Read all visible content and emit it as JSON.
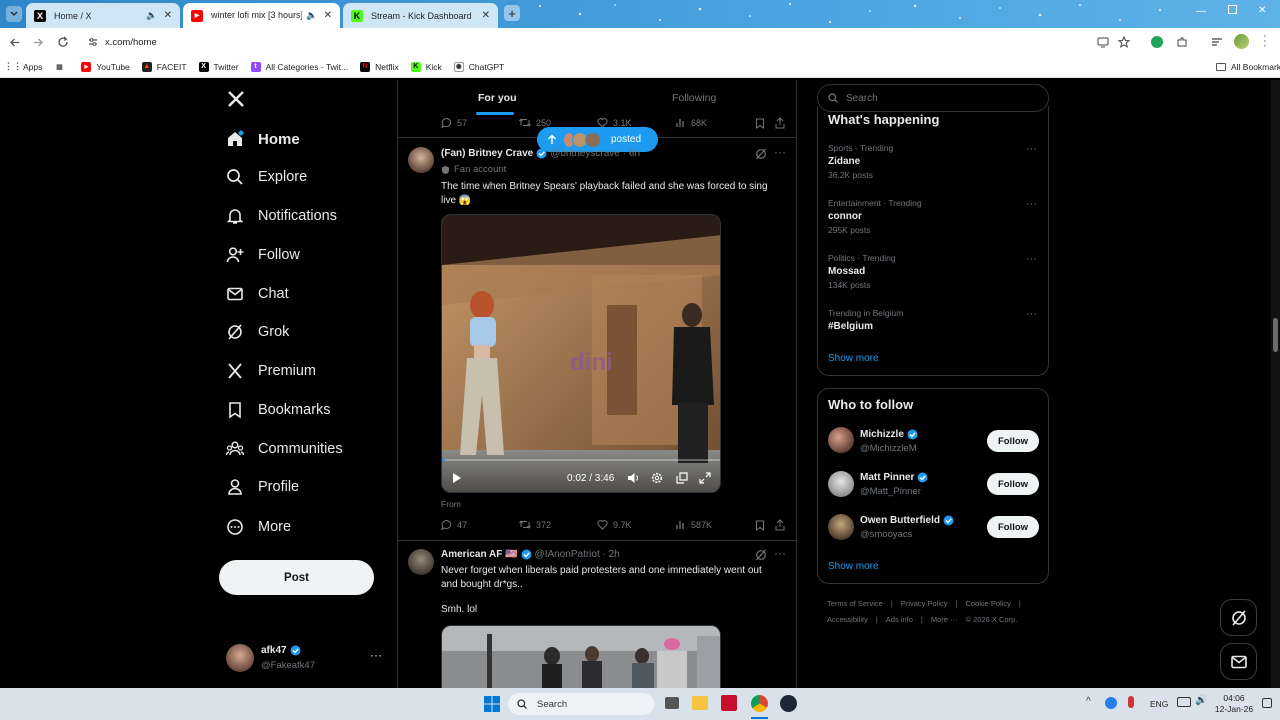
{
  "browser": {
    "tabs": [
      {
        "title": "Home / X",
        "favicon": "X"
      },
      {
        "title": "winter lofi mix [3 hours] ❄️",
        "favicon": "▶"
      },
      {
        "title": "Stream - Kick Dashboard",
        "favicon": "K"
      }
    ],
    "new_tab": "+",
    "url": "x.com/home",
    "bookmarks": [
      "Apps",
      "YouTube",
      "FACEIT",
      "Twitter",
      "All Categories - Twit...",
      "Netflix",
      "Kick",
      "ChatGPT"
    ],
    "all_bookmarks": "All Bookmarks"
  },
  "nav": {
    "items": [
      "Home",
      "Explore",
      "Notifications",
      "Follow",
      "Chat",
      "Grok",
      "Premium",
      "Bookmarks",
      "Communities",
      "Profile",
      "More"
    ],
    "post_button": "Post",
    "account": {
      "name": "afk47",
      "handle": "@Fakeafk47"
    }
  },
  "feed": {
    "tabs": [
      "For you",
      "Following"
    ],
    "top_actions": {
      "replies": "57",
      "reposts": "250",
      "likes": "3.1K",
      "views": "68K"
    },
    "new_posts_pill": "posted",
    "tweet1": {
      "name": "(Fan) Britney Crave",
      "handle": "@britneyscrave · 6h",
      "badge": "Fan account",
      "text": "The time when Britney Spears' playback failed and she was forced to sing live 😱",
      "video_time": "0:02 / 3:46",
      "from_label": "From",
      "replies": "47",
      "reposts": "372",
      "likes": "9.7K",
      "views": "587K"
    },
    "tweet2": {
      "name": "American AF 🇺🇸",
      "handle": "@IAnonPatriot · 2h",
      "text": "Never forget when liberals paid protesters and one immediately went out and bought dr*gs..",
      "text2": "Smh. lol"
    }
  },
  "sidebar": {
    "search_placeholder": "Search",
    "whats_happening": "What's happening",
    "trends": [
      {
        "context": "Sports · Trending",
        "title": "Zidane",
        "posts": "36.2K posts"
      },
      {
        "context": "Entertainment · Trending",
        "title": "connor",
        "posts": "295K posts"
      },
      {
        "context": "Politics · Trending",
        "title": "Mossad",
        "posts": "134K posts"
      },
      {
        "context": "Trending in Belgium",
        "title": "#Belgium",
        "posts": ""
      }
    ],
    "show_more": "Show more",
    "who_to_follow": "Who to follow",
    "suggestions": [
      {
        "name": "Michizzle",
        "handle": "@MichizzleM",
        "button": "Follow"
      },
      {
        "name": "Matt Pinner",
        "handle": "@Matt_Pinner",
        "button": "Follow"
      },
      {
        "name": "Owen Butterfield",
        "handle": "@smooyacs",
        "button": "Follow"
      }
    ],
    "show_more2": "Show more",
    "footer": {
      "line1": [
        "Terms of Service",
        "Privacy Policy",
        "Cookie Policy"
      ],
      "line2": [
        "Accessibility",
        "Ads info",
        "More ···",
        "© 2026 X Corp."
      ]
    }
  },
  "taskbar": {
    "search": "Search",
    "lang": "ENG",
    "time": "04:06",
    "date": "12-Jan-26"
  },
  "colors": {
    "accent": "#1d9bf0",
    "bg": "#000000",
    "border": "#2f3336",
    "muted": "#71767b"
  }
}
